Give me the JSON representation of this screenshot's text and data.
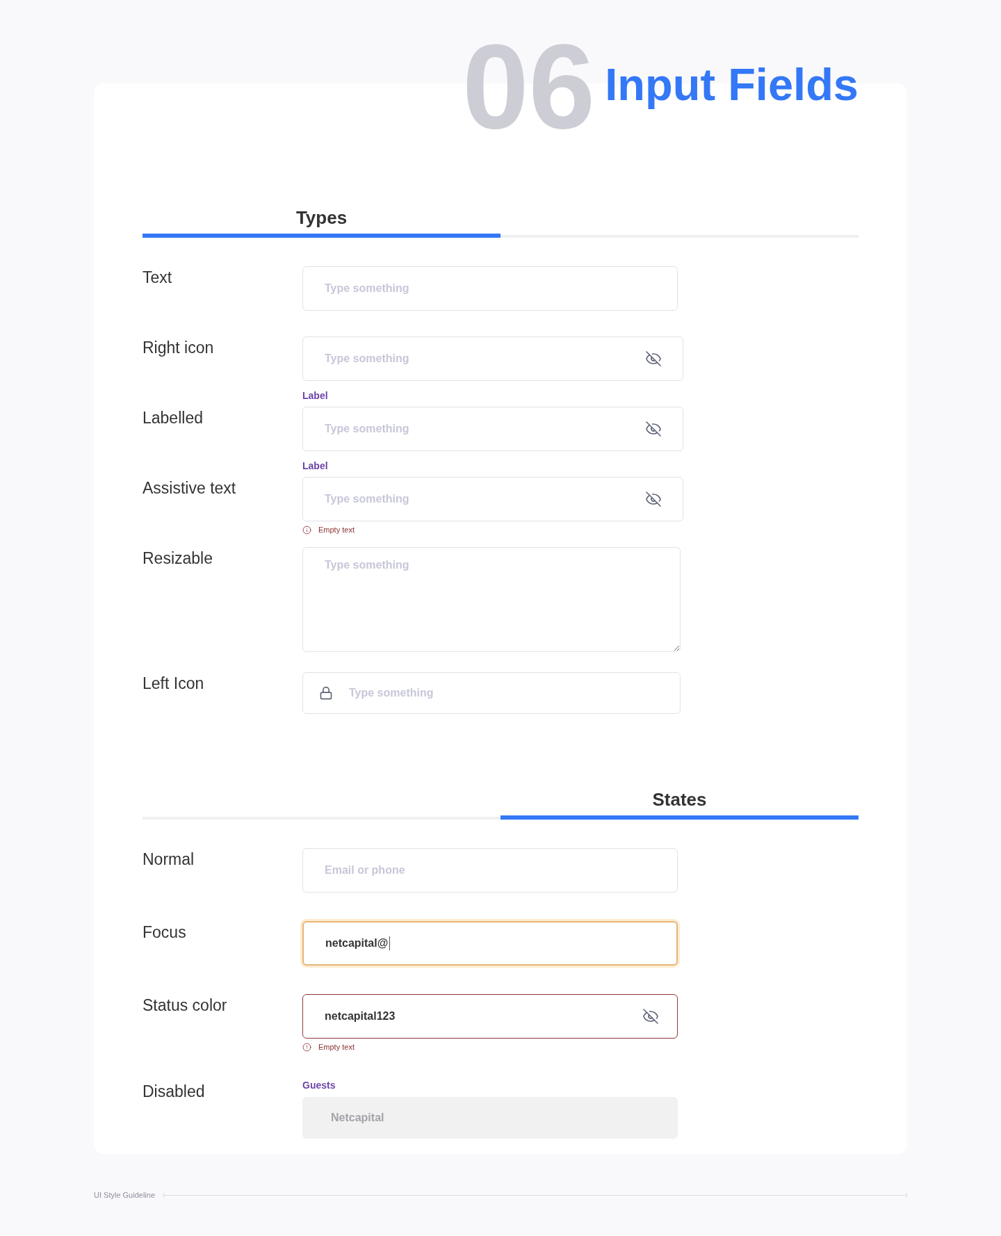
{
  "header": {
    "section_number": "06",
    "title": "Input Fields"
  },
  "sections": [
    {
      "title": "Types",
      "highlight_right": false,
      "rows": [
        {
          "name": "Text",
          "kind": "plain",
          "placeholder": "Type something"
        },
        {
          "name": "Right icon",
          "kind": "trailing_icon",
          "placeholder": "Type something"
        },
        {
          "name": "Labelled",
          "kind": "trailing_icon",
          "label": "Label",
          "placeholder": "Type something"
        },
        {
          "name": "Assistive text",
          "kind": "trailing_icon",
          "label": "Label",
          "placeholder": "Type something",
          "error": "Empty text"
        },
        {
          "name": "Resizable",
          "kind": "textarea",
          "placeholder": "Type something"
        },
        {
          "name": "Left Icon",
          "kind": "leading_icon",
          "placeholder": "Type something"
        }
      ]
    },
    {
      "title": "States",
      "highlight_right": true,
      "rows": [
        {
          "name": "Normal",
          "kind": "plain",
          "focused": false,
          "invalid": false,
          "disabled": false,
          "placeholder": "Email or phone"
        },
        {
          "name": "Focus",
          "kind": "plain",
          "focused": true,
          "invalid": false,
          "disabled": false,
          "value": "netcapital@"
        },
        {
          "name": "Status color",
          "kind": "trailing_icon",
          "focused": false,
          "invalid": true,
          "disabled": false,
          "value": "netcapital123",
          "error": "Empty text"
        },
        {
          "name": "Disabled",
          "kind": "plain",
          "focused": false,
          "invalid": false,
          "disabled": true,
          "label": "Guests",
          "value": "Netcapital"
        }
      ]
    }
  ],
  "footer": {
    "text": "UI Style Guideline"
  }
}
